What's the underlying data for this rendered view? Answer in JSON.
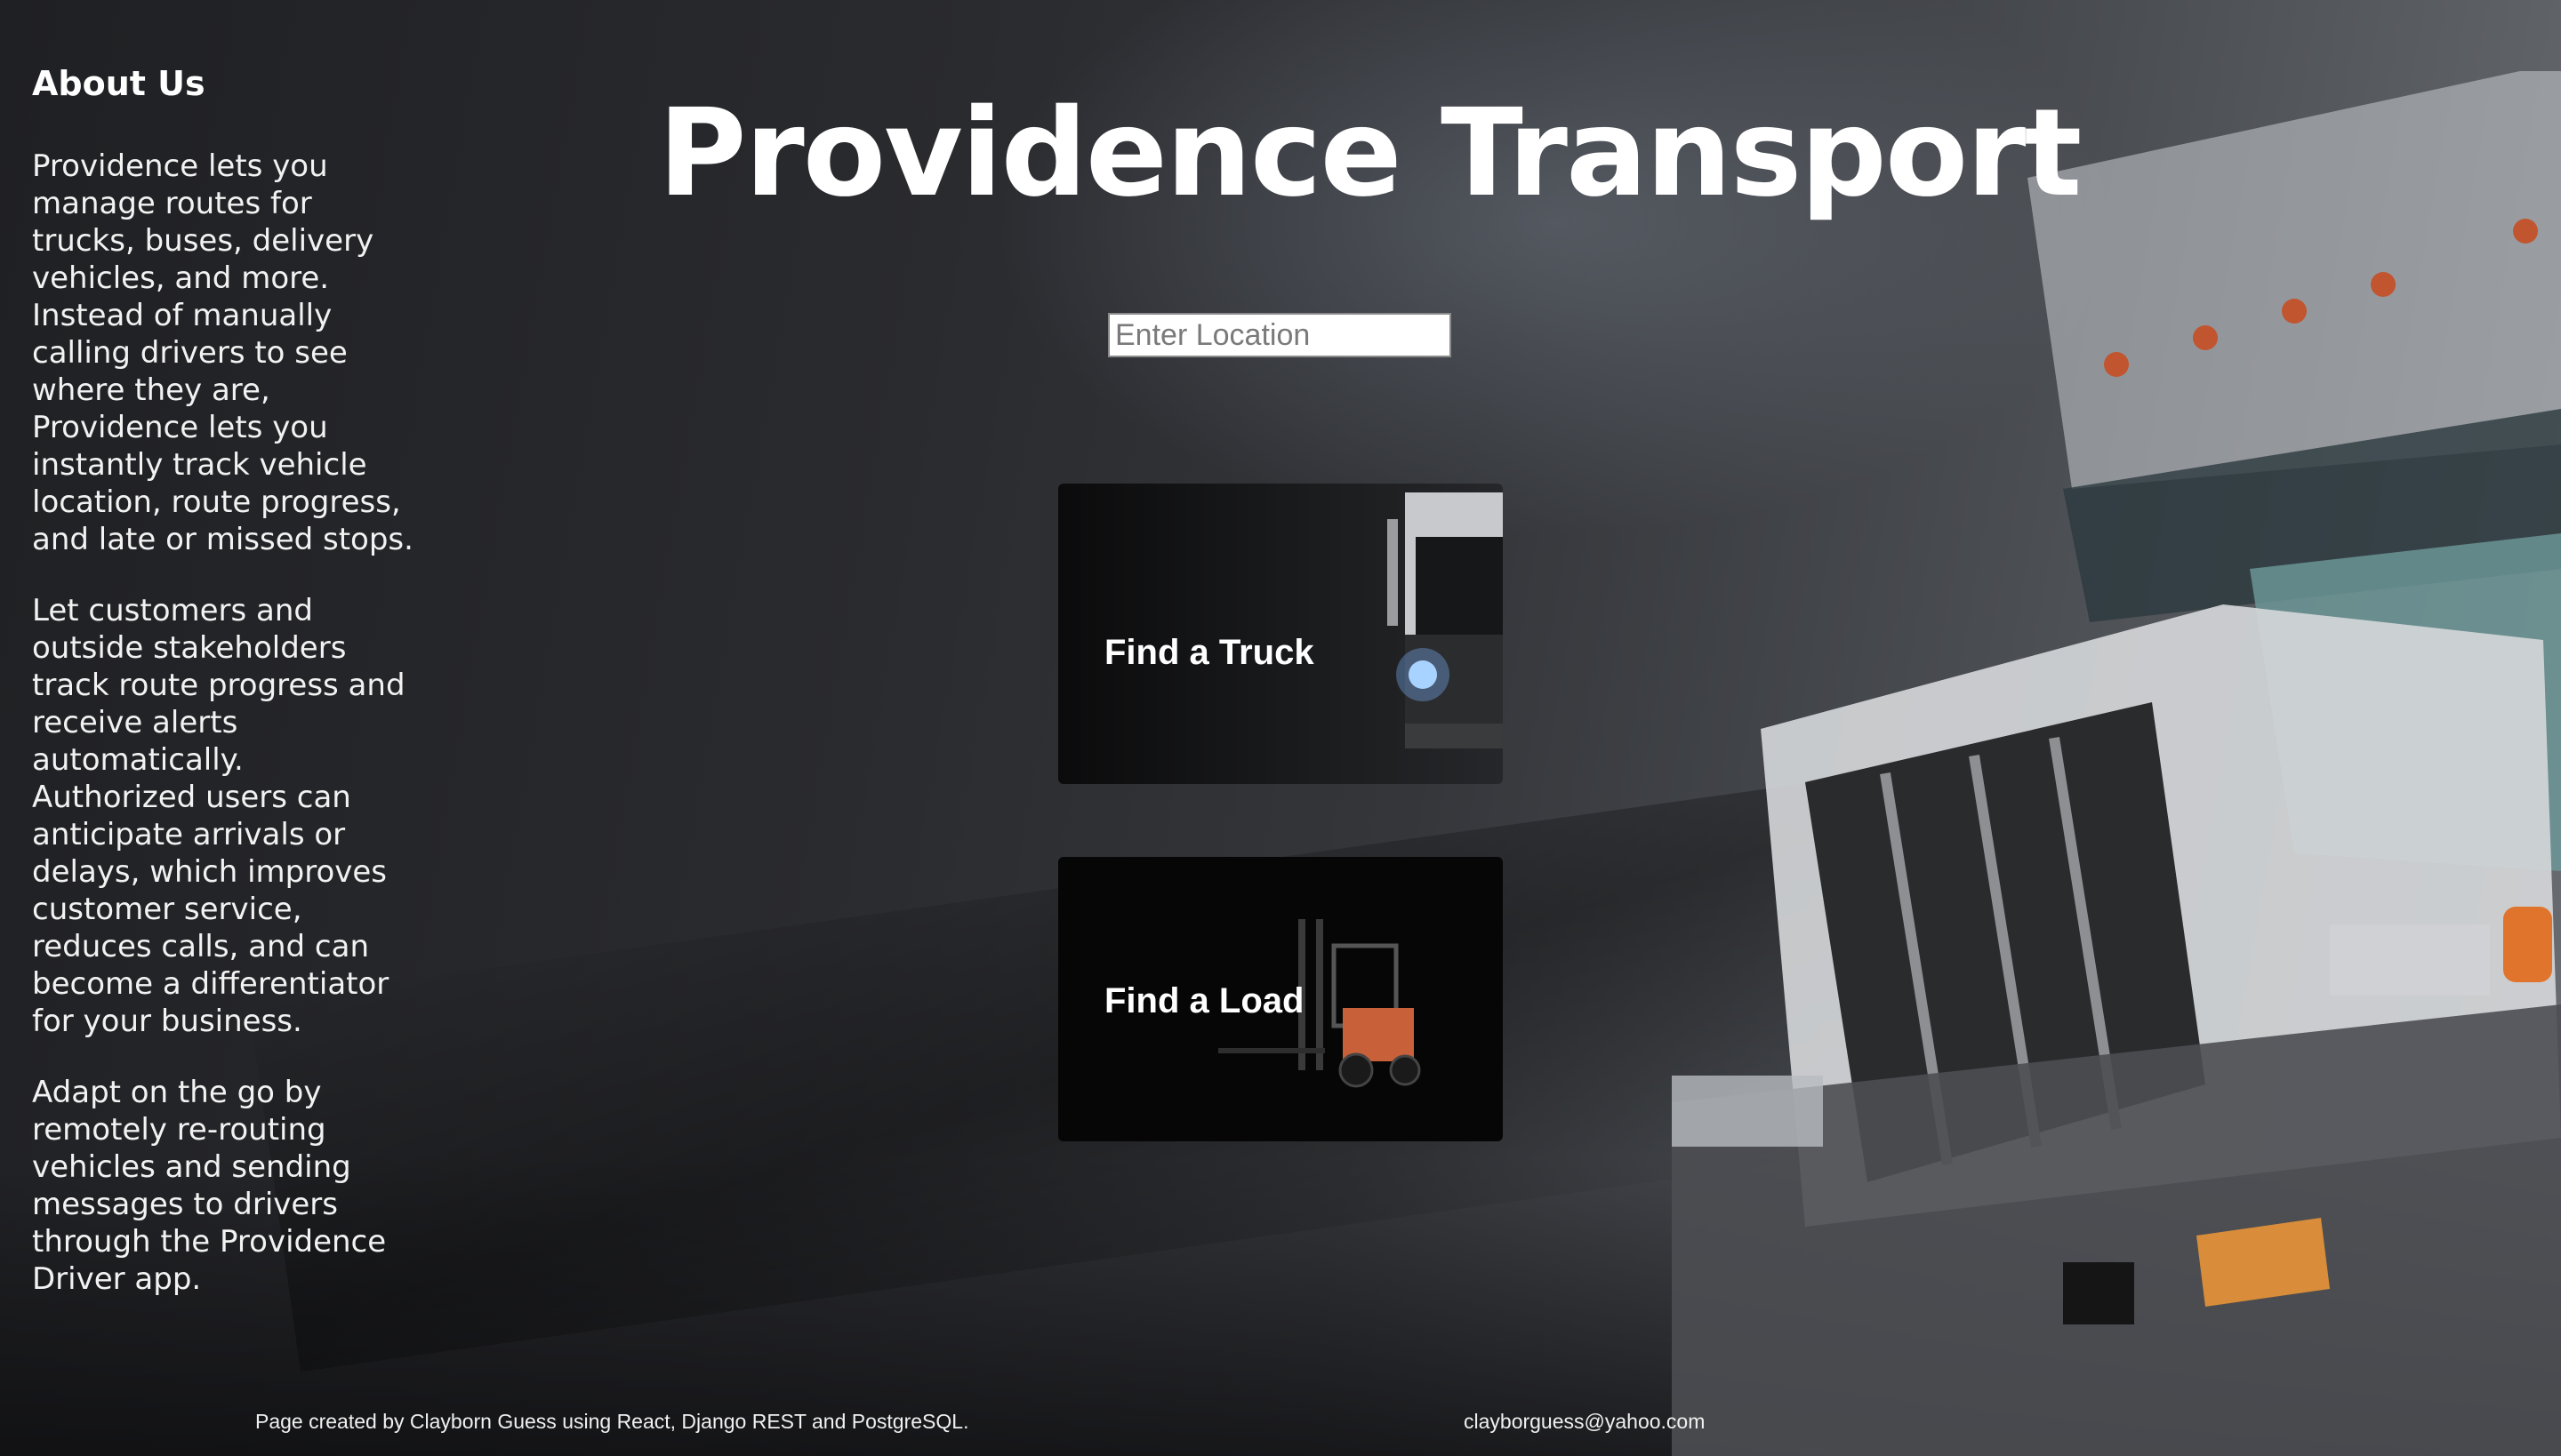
{
  "about": {
    "heading": "About Us",
    "paragraphs": [
      "Providence lets you manage routes for trucks, buses, delivery vehicles, and more. Instead of manually calling drivers to see where they are, Providence lets you instantly track vehicle location, route progress, and late or missed stops.",
      "Let customers and outside stakeholders track route progress and receive alerts automatically. Authorized users can anticipate arrivals or delays, which improves customer service, reduces calls, and can become a differentiator for your business.",
      "Adapt on the go by remotely re-routing vehicles and sending messages to drivers through the Providence Driver app."
    ]
  },
  "header": {
    "title": "Providence Transport"
  },
  "search": {
    "placeholder": "Enter Location",
    "value": ""
  },
  "cards": {
    "truck": {
      "label": "Find a Truck",
      "image": "truck-front-photo"
    },
    "load": {
      "label": "Find a Load",
      "image": "forklift-photo"
    }
  },
  "footer": {
    "credit": "Page created by Clayborn Guess using React, Django REST and PostgreSQL.",
    "email": "clayborguess@yahoo.com"
  },
  "colors": {
    "text": "#ffffff",
    "card_bg": "#0b0b0c",
    "forklift_accent": "#c8603a"
  }
}
